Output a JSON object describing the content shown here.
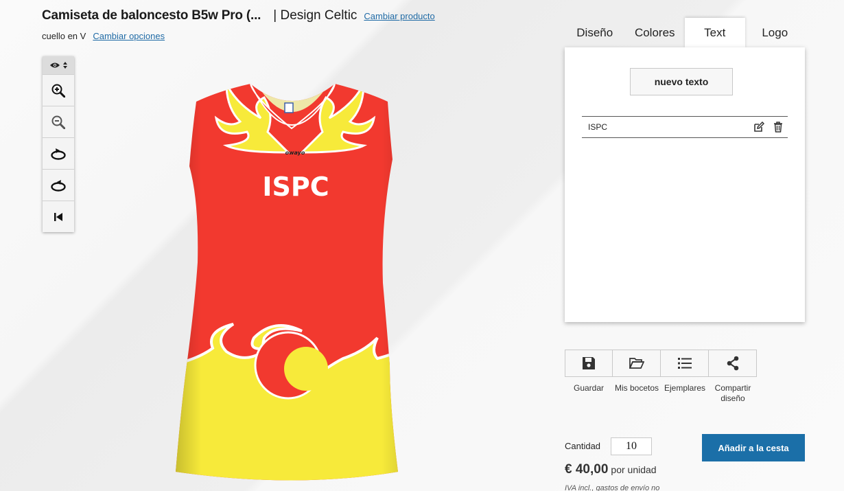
{
  "header": {
    "product_title": "Camiseta de baloncesto B5w Pro (...",
    "design_name": "| Design Celtic",
    "change_product_link": "Cambiar producto",
    "selected_option": "cuello en V",
    "change_options_link": "Cambiar opciones"
  },
  "view_toolbar": {
    "tools": [
      "eye-visibility-icon",
      "zoom-in-icon",
      "zoom-out-icon",
      "rotate-right-icon",
      "rotate-left-icon",
      "reset-view-icon"
    ]
  },
  "jersey": {
    "chest_text": "ISPC",
    "brand_logo": "owayo",
    "colors": {
      "body": "#f2392f",
      "accent": "#f7ea3a",
      "trim": "#ffffff"
    }
  },
  "tabs": [
    {
      "label": "Diseño",
      "active": false
    },
    {
      "label": "Colores",
      "active": false
    },
    {
      "label": "Text",
      "active": true
    },
    {
      "label": "Logo",
      "active": false
    }
  ],
  "text_panel": {
    "new_text_button": "nuevo texto",
    "items": [
      {
        "label": "ISPC"
      }
    ]
  },
  "actions": [
    {
      "label": "Guardar",
      "icon": "save-icon"
    },
    {
      "label": "Mis bocetos",
      "icon": "folder-open-icon"
    },
    {
      "label": "Ejemplares",
      "icon": "list-icon"
    },
    {
      "label": "Compartir diseño",
      "icon": "share-icon"
    }
  ],
  "purchase": {
    "quantity_label": "Cantidad",
    "quantity_value": "10",
    "add_to_cart": "Añadir a la cesta",
    "price": "€ 40,00",
    "price_unit": "por unidad",
    "tax_note": "IVA incl., gastos de envío no"
  },
  "colors": {
    "link": "#1f6aa5",
    "primary_button": "#1b6fa8"
  }
}
